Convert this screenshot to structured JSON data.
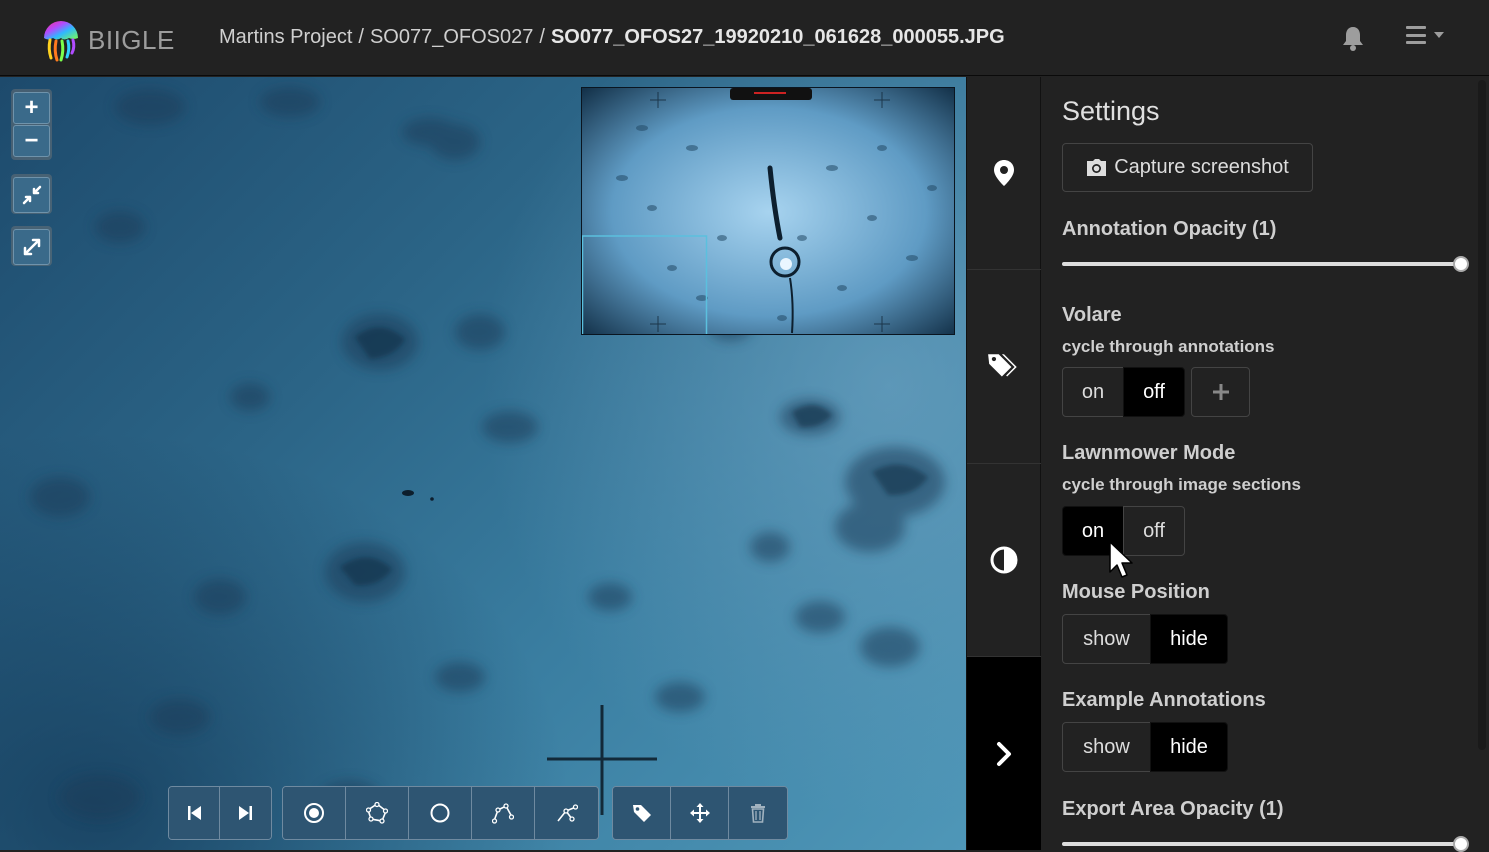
{
  "app": {
    "brand": "BIIGLE",
    "breadcrumb": {
      "project": "Martins Project",
      "volume": "SO077_OFOS027",
      "separator": "/",
      "image": "SO077_OFOS27_19920210_061628_000055.JPG"
    },
    "icons": {
      "notifications": "bell-icon",
      "menu": "hamburger-menu-icon"
    }
  },
  "map_controls": {
    "zoom_in": "+",
    "zoom_out": "−",
    "zoom_fit_icon": "compress-icon",
    "fullscreen_icon": "expand-icon"
  },
  "toolbar": {
    "groups": [
      [
        "previous-image",
        "next-image"
      ],
      [
        "draw-point",
        "draw-polygon",
        "draw-circle",
        "draw-line-string",
        "draw-magic-wand"
      ],
      [
        "attach-label",
        "translate",
        "delete"
      ]
    ]
  },
  "side_tabs": [
    "annotations-tab",
    "labels-tab",
    "color-adjustment-tab",
    "collapse-sidebar"
  ],
  "settings": {
    "title": "Settings",
    "capture_screenshot": "Capture screenshot",
    "annotation_opacity": {
      "label": "Annotation Opacity (1)",
      "value": 1
    },
    "volare": {
      "label": "Volare",
      "help": "cycle through annotations",
      "on": "on",
      "off": "off",
      "selected": "off",
      "add": "+"
    },
    "lawnmower": {
      "label": "Lawnmower Mode",
      "help": "cycle through image sections",
      "on": "on",
      "off": "off",
      "selected": "on"
    },
    "mouse_position": {
      "label": "Mouse Position",
      "show": "show",
      "hide": "hide",
      "selected": "hide"
    },
    "example_annotations": {
      "label": "Example Annotations",
      "show": "show",
      "hide": "hide",
      "selected": "hide"
    },
    "export_area_opacity": {
      "label": "Export Area Opacity (1)",
      "value": 1
    }
  },
  "colors": {
    "navbar": "#222222",
    "panel": "#222222",
    "active_button": "#000000",
    "minimap_viewport": "#5bc0de"
  }
}
